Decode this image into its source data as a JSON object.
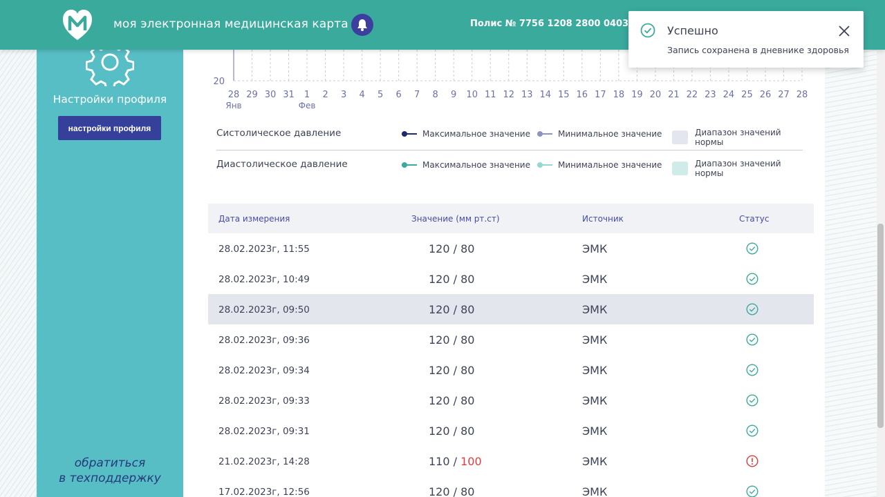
{
  "header": {
    "app_title": "моя электронная медицинская карта",
    "policy": "Полис № 7756 1208 2800 0403",
    "logo_icon": "heart-m-logo-icon",
    "bell_icon": "bell-icon"
  },
  "sidebar": {
    "icon": "gear-icon",
    "title": "Настройки профиля",
    "profile_button": "настройки профиля",
    "support_line1": "обратиться",
    "support_line2": "в техподдержку"
  },
  "chart_data": {
    "type": "line",
    "y_tick_visible": "20",
    "x_ticks": [
      "28",
      "29",
      "30",
      "31",
      "1",
      "2",
      "3",
      "4",
      "5",
      "6",
      "7",
      "8",
      "9",
      "10",
      "11",
      "12",
      "13",
      "14",
      "15",
      "16",
      "17",
      "18",
      "19",
      "20",
      "21",
      "22",
      "23",
      "24",
      "25",
      "26",
      "27",
      "28"
    ],
    "month_labels": [
      {
        "at": "28",
        "label": "Янв"
      },
      {
        "at": "1",
        "label": "Фев"
      }
    ],
    "grid": true
  },
  "legend": {
    "rows": [
      {
        "name": "Систолическое давление",
        "max_label": "Максимальное значение",
        "min_label": "Минимальное значение",
        "range_label": "Диапазон значений нормы",
        "max_color": "#1e2a6e",
        "min_color": "#8f94be",
        "range_color": "#e3e5ef"
      },
      {
        "name": "Диастолическое давление",
        "max_label": "Максимальное значение",
        "min_label": "Минимальное значение",
        "range_label": "Диапазон значений нормы",
        "max_color": "#3aaa9d",
        "min_color": "#94d8d0",
        "range_color": "#cfece8"
      }
    ]
  },
  "table": {
    "headers": {
      "date": "Дата измерения",
      "value": "Значение (мм рт.ст)",
      "source": "Источник",
      "status": "Статус"
    },
    "rows": [
      {
        "date": "28.02.2023г, 11:55",
        "sys": "120",
        "sep": " / ",
        "dia": "80",
        "source": "ЭМК",
        "status": "ok"
      },
      {
        "date": "28.02.2023г, 10:49",
        "sys": "120",
        "sep": " / ",
        "dia": "80",
        "source": "ЭМК",
        "status": "ok"
      },
      {
        "date": "28.02.2023г, 09:50",
        "sys": "120",
        "sep": " / ",
        "dia": "80",
        "source": "ЭМК",
        "status": "ok"
      },
      {
        "date": "28.02.2023г, 09:36",
        "sys": "120",
        "sep": " / ",
        "dia": "80",
        "source": "ЭМК",
        "status": "ok"
      },
      {
        "date": "28.02.2023г, 09:34",
        "sys": "120",
        "sep": " / ",
        "dia": "80",
        "source": "ЭМК",
        "status": "ok"
      },
      {
        "date": "28.02.2023г, 09:33",
        "sys": "120",
        "sep": " / ",
        "dia": "80",
        "source": "ЭМК",
        "status": "ok"
      },
      {
        "date": "28.02.2023г, 09:31",
        "sys": "120",
        "sep": " / ",
        "dia": "80",
        "source": "ЭМК",
        "status": "ok"
      },
      {
        "date": "21.02.2023г, 14:28",
        "sys": "110",
        "sep": " / ",
        "dia": "100",
        "source": "ЭМК",
        "status": "warning"
      },
      {
        "date": "17.02.2023г, 12:56",
        "sys": "120",
        "sep": " / ",
        "dia": "80",
        "source": "ЭМК",
        "status": "ok"
      }
    ]
  },
  "toast": {
    "icon": "check-circle-icon",
    "title": "Успешно",
    "message": "Запись сохранена в дневнике здоровья",
    "close_icon": "close-icon"
  },
  "colors": {
    "header_bg": "#3aaa9d",
    "sidebar_bg": "#57bec5",
    "button_bg": "#34409a",
    "ok_color": "#3aaa9d",
    "warning_color": "#e23b3b"
  }
}
